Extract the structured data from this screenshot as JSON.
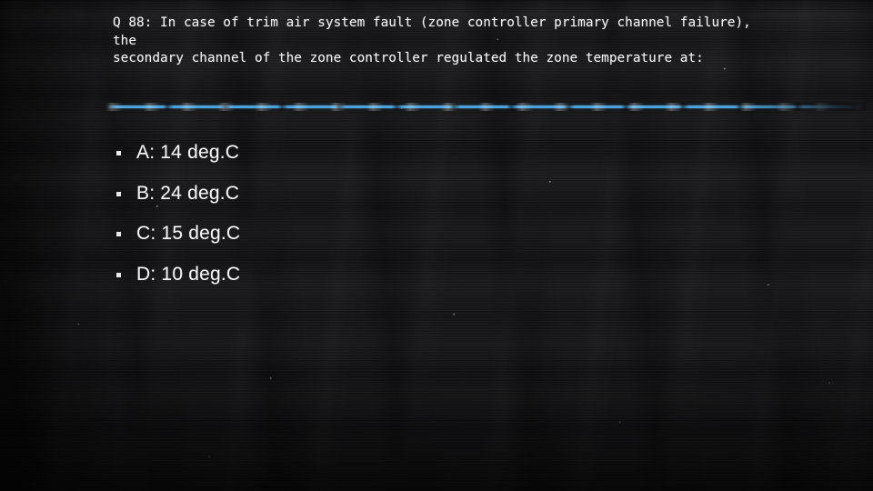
{
  "slide": {
    "background_color": "#111113",
    "text_color": "#f2f2f2",
    "accent_color": "#4ba2d8",
    "title": "Q 88: In case of trim air system fault (zone controller primary channel failure), the\nsecondary channel of the zone controller regulated the zone temperature at:",
    "divider": {
      "name": "accent-rule",
      "color": "#4ba2d8"
    },
    "bullets": [
      {
        "marker": "square-bullet",
        "label": "A: 14 deg.C"
      },
      {
        "marker": "square-bullet",
        "label": "B: 24 deg.C"
      },
      {
        "marker": "square-bullet",
        "label": "C: 15 deg.C"
      },
      {
        "marker": "square-bullet",
        "label": "D: 10 deg.C"
      }
    ]
  }
}
